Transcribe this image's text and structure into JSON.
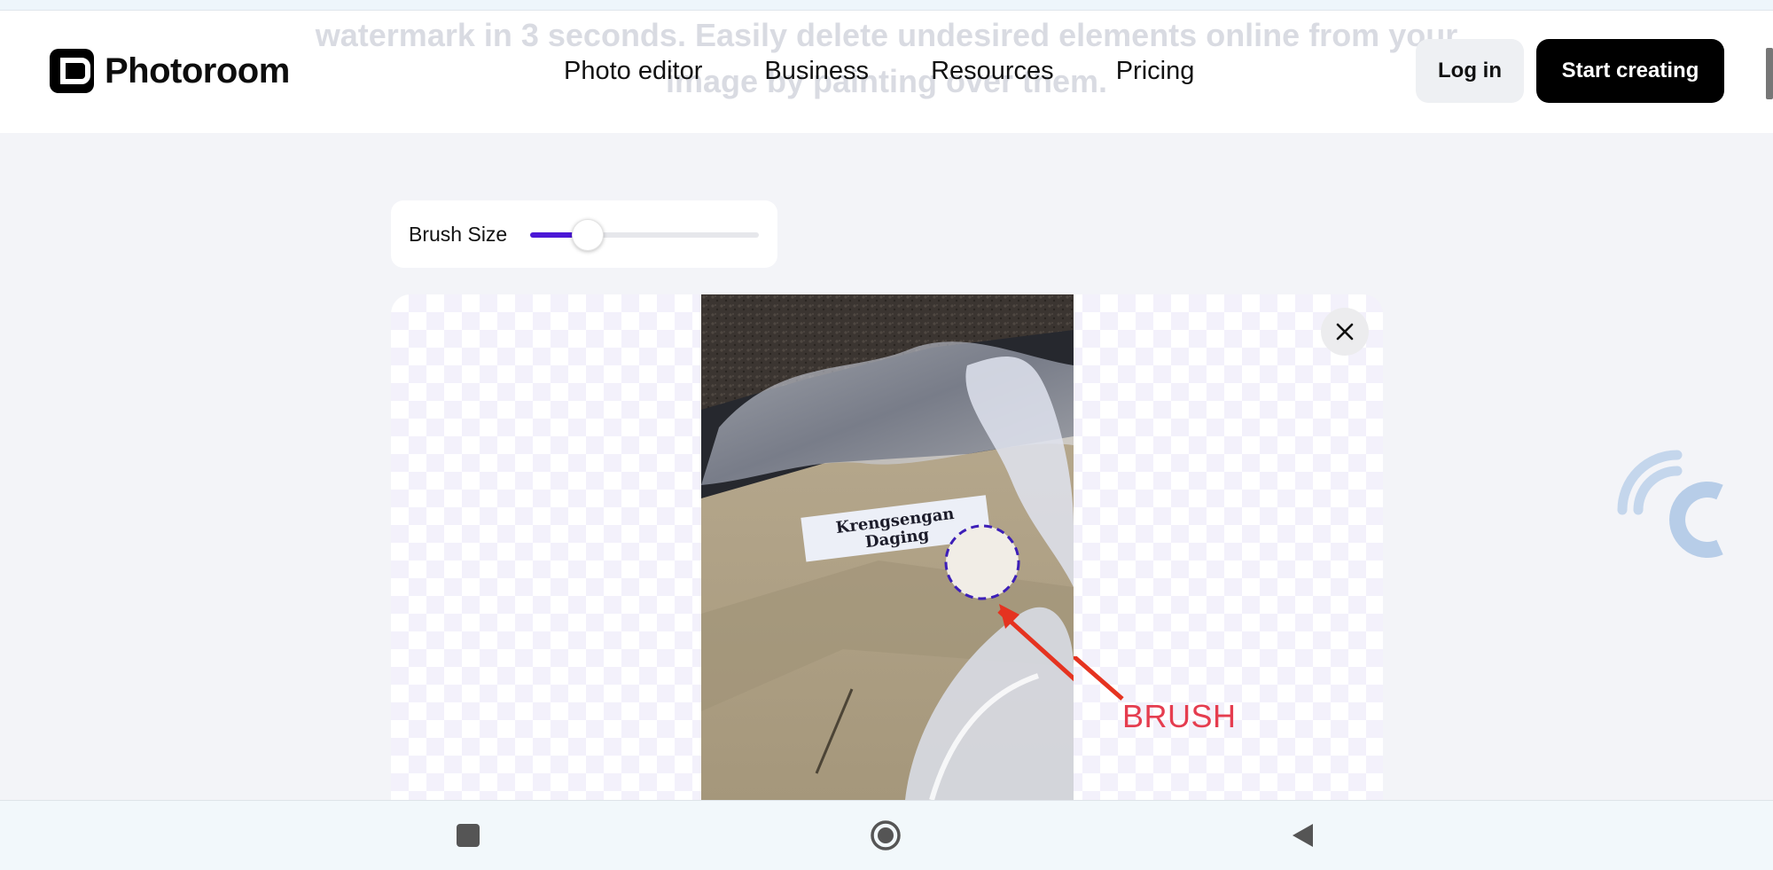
{
  "header": {
    "ghost_text_line1": "watermark in 3 seconds. Easily delete undesired elements online from your",
    "ghost_text_line2": "image by painting over them.",
    "logo_text": "Photoroom",
    "nav": [
      "Photo editor",
      "Business",
      "Resources",
      "Pricing"
    ],
    "login_label": "Log in",
    "start_label": "Start creating"
  },
  "editor": {
    "brush_label": "Brush Size",
    "brush_size_fraction": 0.25,
    "photo_label_line1": "Krengsengan",
    "photo_label_line2": "Daging",
    "annotation": "BRUSH"
  },
  "colors": {
    "accent": "#4b17d6",
    "annotation": "#e53d4f",
    "button_dark": "#000000"
  },
  "icons": {
    "close": "close-icon",
    "watermark": "watermark-logo",
    "android_recent": "square-icon",
    "android_home": "circle-icon",
    "android_back": "triangle-back-icon"
  }
}
